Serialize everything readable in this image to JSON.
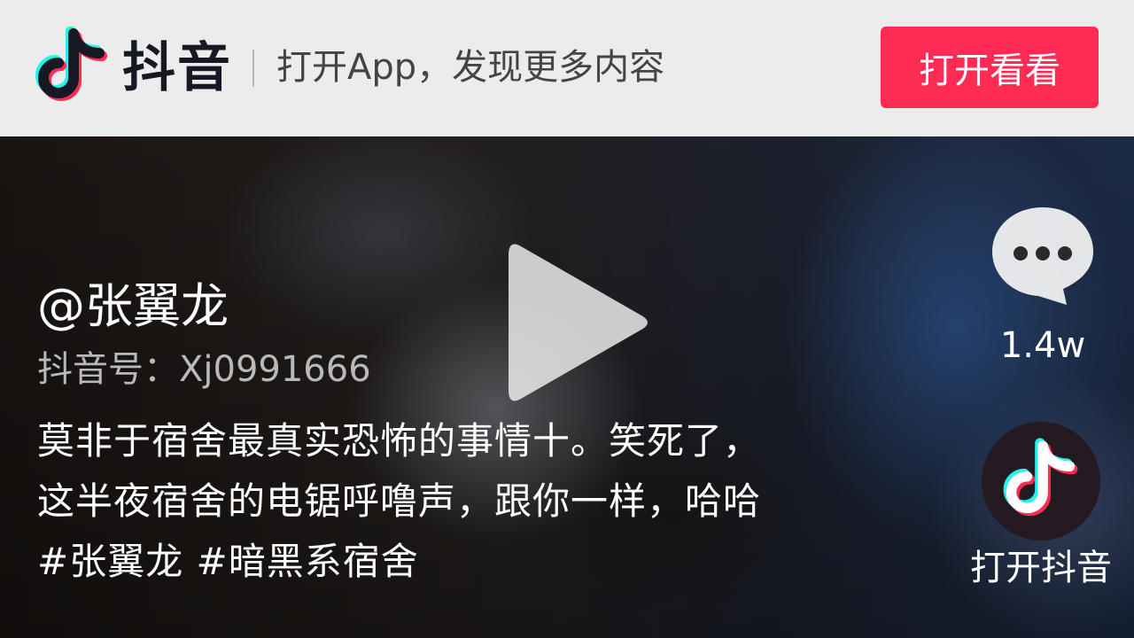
{
  "header": {
    "brand": "抖音",
    "slogan": "打开App，发现更多内容",
    "open_button": "打开看看"
  },
  "video": {
    "username": "@张翼龙",
    "douyin_id": "抖音号：Xj0991666",
    "caption": "莫非于宿舍最真实恐怖的事情十。笑死了，这半夜宿舍的电锯呼噜声，跟你一样，哈哈 #张翼龙 #暗黑系宿舍"
  },
  "sidebar": {
    "comment_count": "1.4w",
    "open_app_label": "打开抖音"
  },
  "colors": {
    "accent": "#fe2c55",
    "brand_cyan": "#25f4ee",
    "brand_red": "#fe2c55"
  },
  "icons": [
    "douyin-logo-icon",
    "play-icon",
    "comment-icon",
    "douyin-app-icon"
  ]
}
